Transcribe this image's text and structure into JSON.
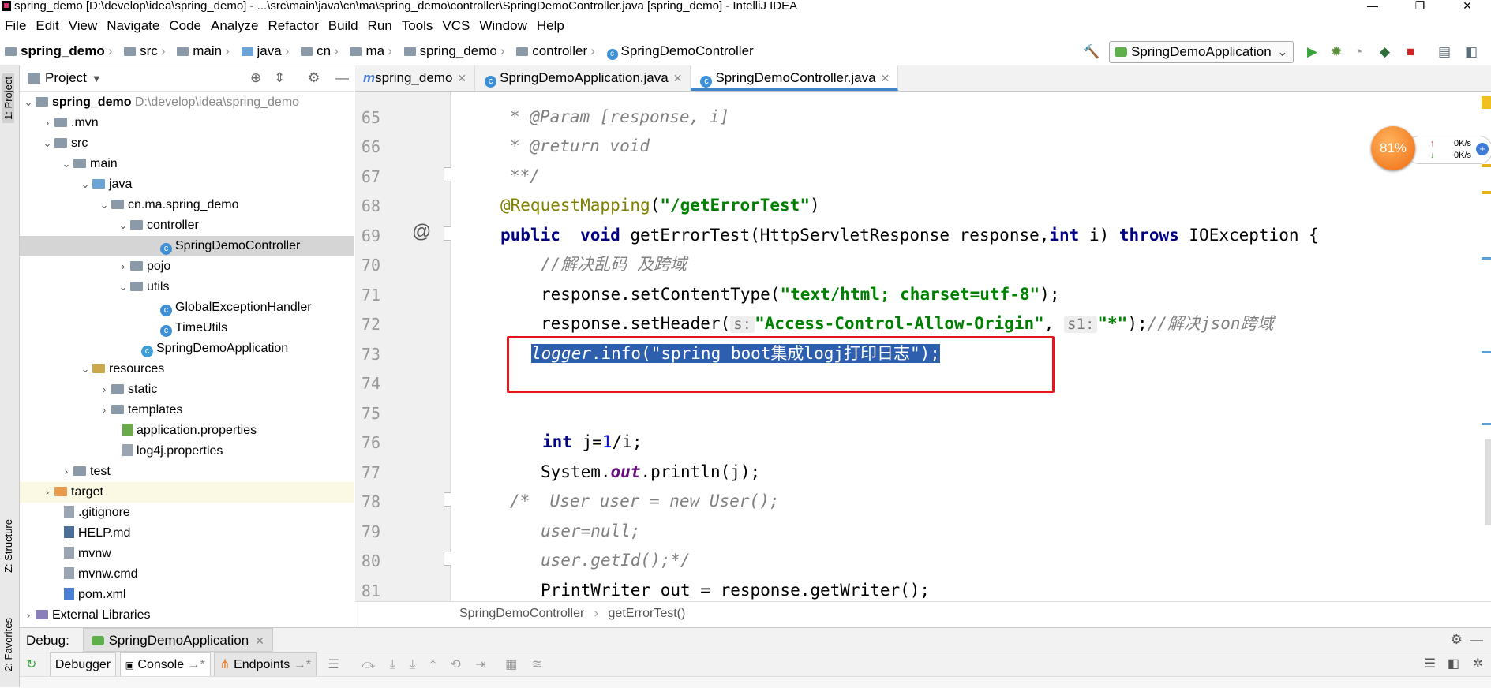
{
  "window": {
    "title": "spring_demo [D:\\develop\\idea\\spring_demo] - ...\\src\\main\\java\\cn\\ma\\spring_demo\\controller\\SpringDemoController.java [spring_demo] - IntelliJ IDEA",
    "controls": [
      "—",
      "❐",
      "✕"
    ]
  },
  "menu": [
    "File",
    "Edit",
    "View",
    "Navigate",
    "Code",
    "Analyze",
    "Refactor",
    "Build",
    "Run",
    "Tools",
    "VCS",
    "Window",
    "Help"
  ],
  "nav": {
    "crumbs": [
      "spring_demo",
      "src",
      "main",
      "java",
      "cn",
      "ma",
      "spring_demo",
      "controller",
      "SpringDemoController"
    ],
    "run_config": "SpringDemoApplication"
  },
  "left_stripe": {
    "project": "1: Project",
    "structure": "Z: Structure",
    "favorites": "2: Favorites"
  },
  "project": {
    "header": "Project",
    "tree": [
      {
        "label": "spring_demo",
        "extra": "D:\\develop\\idea\\spring_demo"
      },
      {
        "label": ".mvn"
      },
      {
        "label": "src"
      },
      {
        "label": "main"
      },
      {
        "label": "java"
      },
      {
        "label": "cn.ma.spring_demo"
      },
      {
        "label": "controller"
      },
      {
        "label": "SpringDemoController"
      },
      {
        "label": "pojo"
      },
      {
        "label": "utils"
      },
      {
        "label": "GlobalExceptionHandler"
      },
      {
        "label": "TimeUtils"
      },
      {
        "label": "SpringDemoApplication"
      },
      {
        "label": "resources"
      },
      {
        "label": "static"
      },
      {
        "label": "templates"
      },
      {
        "label": "application.properties"
      },
      {
        "label": "log4j.properties"
      },
      {
        "label": "test"
      },
      {
        "label": "target"
      },
      {
        "label": ".gitignore"
      },
      {
        "label": "HELP.md"
      },
      {
        "label": "mvnw"
      },
      {
        "label": "mvnw.cmd"
      },
      {
        "label": "pom.xml"
      },
      {
        "label": "External Libraries"
      }
    ]
  },
  "tabs": [
    {
      "label": "spring_demo",
      "icon": "m"
    },
    {
      "label": "SpringDemoApplication.java",
      "icon": "c"
    },
    {
      "label": "SpringDemoController.java",
      "icon": "c"
    }
  ],
  "editor": {
    "lines": [
      "65",
      "66",
      "67",
      "68",
      "69",
      "70",
      "71",
      "72",
      "73",
      "74",
      "75",
      "76",
      "77",
      "78",
      "79",
      "80",
      "81"
    ],
    "code": {
      "l65": "* @Param [response, i]",
      "l66": "* @return void",
      "l67": "**/",
      "l68_ann": "@RequestMapping",
      "l68_str": "\"/getErrorTest\"",
      "l69_a": "public",
      "l69_b": "void",
      "l69_c": " getErrorTest(HttpServletResponse response,",
      "l69_d": "int",
      "l69_e": " i) ",
      "l69_f": "throws",
      "l69_g": " IOException {",
      "l70": "//解决乱码 及跨域",
      "l71_a": "response.setContentType(",
      "l71_b": "\"text/html; charset=utf-8\"",
      "l71_c": ");",
      "l72_a": "response.setHeader(",
      "l72_hint1": "s:",
      "l72_b": "\"Access-Control-Allow-Origin\"",
      "l72_c": ", ",
      "l72_hint2": "s1:",
      "l72_d": "\"*\"",
      "l72_e": ");",
      "l72_f": "//解决json跨域",
      "l73_a": "logger",
      "l73_b": ".info(",
      "l73_c": "\"spring boot集成logj打印日志\"",
      "l73_d": ");",
      "l76_a": "int",
      "l76_b": " j=",
      "l76_c": "1",
      "l76_d": "/i;",
      "l77_a": "System.",
      "l77_b": "out",
      "l77_c": ".println(j);",
      "l78": "/*  User user = new User();",
      "l79": "user=null;",
      "l80": "user.getId();*/",
      "l81": "PrintWriter out = response.getWriter();"
    },
    "breadcrumb": [
      "SpringDemoController",
      "getErrorTest()"
    ]
  },
  "speed_widget": {
    "percent": "81%",
    "up": "0K/s",
    "down": "0K/s"
  },
  "debug": {
    "label": "Debug:",
    "session": "SpringDemoApplication",
    "tabs": [
      "Debugger",
      "Console",
      "Endpoints"
    ]
  },
  "colors": {
    "accent": "#4083c9",
    "selection": "#2d5fae",
    "redbox": "#e8141e",
    "current_line": "#fbf8e0"
  }
}
